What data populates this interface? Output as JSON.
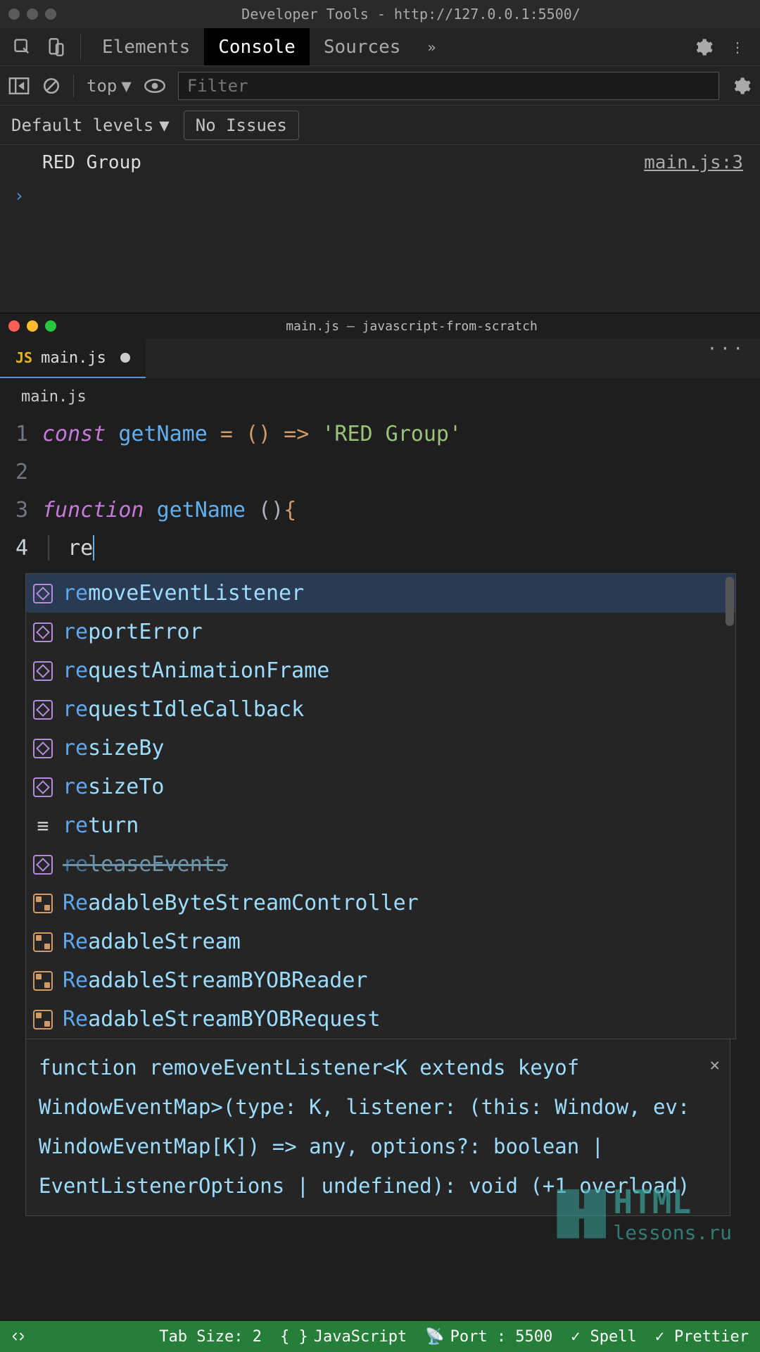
{
  "devtools": {
    "title": "Developer Tools - http://127.0.0.1:5500/",
    "tabs": {
      "elements": "Elements",
      "console": "Console",
      "sources": "Sources"
    },
    "context": "top",
    "filter_placeholder": "Filter",
    "levels": "Default levels",
    "no_issues": "No Issues",
    "log": {
      "message": "RED Group",
      "location": "main.js:3"
    }
  },
  "vscode": {
    "title": "main.js — javascript-from-scratch",
    "tab_filename": "main.js",
    "js_badge": "JS",
    "breadcrumb": "main.js",
    "code": {
      "l1_const": "const",
      "l1_name": "getName",
      "l1_eq": " = ",
      "l1_paren": "()",
      "l1_arrow": " => ",
      "l1_str": "'RED Group'",
      "l3_func": "function",
      "l3_name": "getName",
      "l3_paren": " ()",
      "l3_brace": "{",
      "l4_typed": "re"
    },
    "autocomplete": [
      {
        "label": "removeEventListener",
        "icon": "cube",
        "deprecated": false
      },
      {
        "label": "reportError",
        "icon": "cube",
        "deprecated": false
      },
      {
        "label": "requestAnimationFrame",
        "icon": "cube",
        "deprecated": false
      },
      {
        "label": "requestIdleCallback",
        "icon": "cube",
        "deprecated": false
      },
      {
        "label": "resizeBy",
        "icon": "cube",
        "deprecated": false
      },
      {
        "label": "resizeTo",
        "icon": "cube",
        "deprecated": false
      },
      {
        "label": "return",
        "icon": "kw",
        "deprecated": false
      },
      {
        "label": "releaseEvents",
        "icon": "cube",
        "deprecated": true
      },
      {
        "label": "ReadableByteStreamController",
        "icon": "class",
        "deprecated": false
      },
      {
        "label": "ReadableStream",
        "icon": "class",
        "deprecated": false
      },
      {
        "label": "ReadableStreamBYOBReader",
        "icon": "class",
        "deprecated": false
      },
      {
        "label": "ReadableStreamBYOBRequest",
        "icon": "class",
        "deprecated": false
      }
    ],
    "detail": "function removeEventListener<K extends keyof WindowEventMap>(type: K, listener: (this: Window, ev: WindowEventMap[K]) => any, options?: boolean | EventListenerOptions | undefined): void (+1 overload)"
  },
  "statusbar": {
    "tabsize": "Tab Size: 2",
    "lang": "JavaScript",
    "port": "Port : 5500",
    "spell": "Spell",
    "prettier": "Prettier"
  },
  "watermark": {
    "text": "HTML",
    "sub": "lessons.ru"
  }
}
